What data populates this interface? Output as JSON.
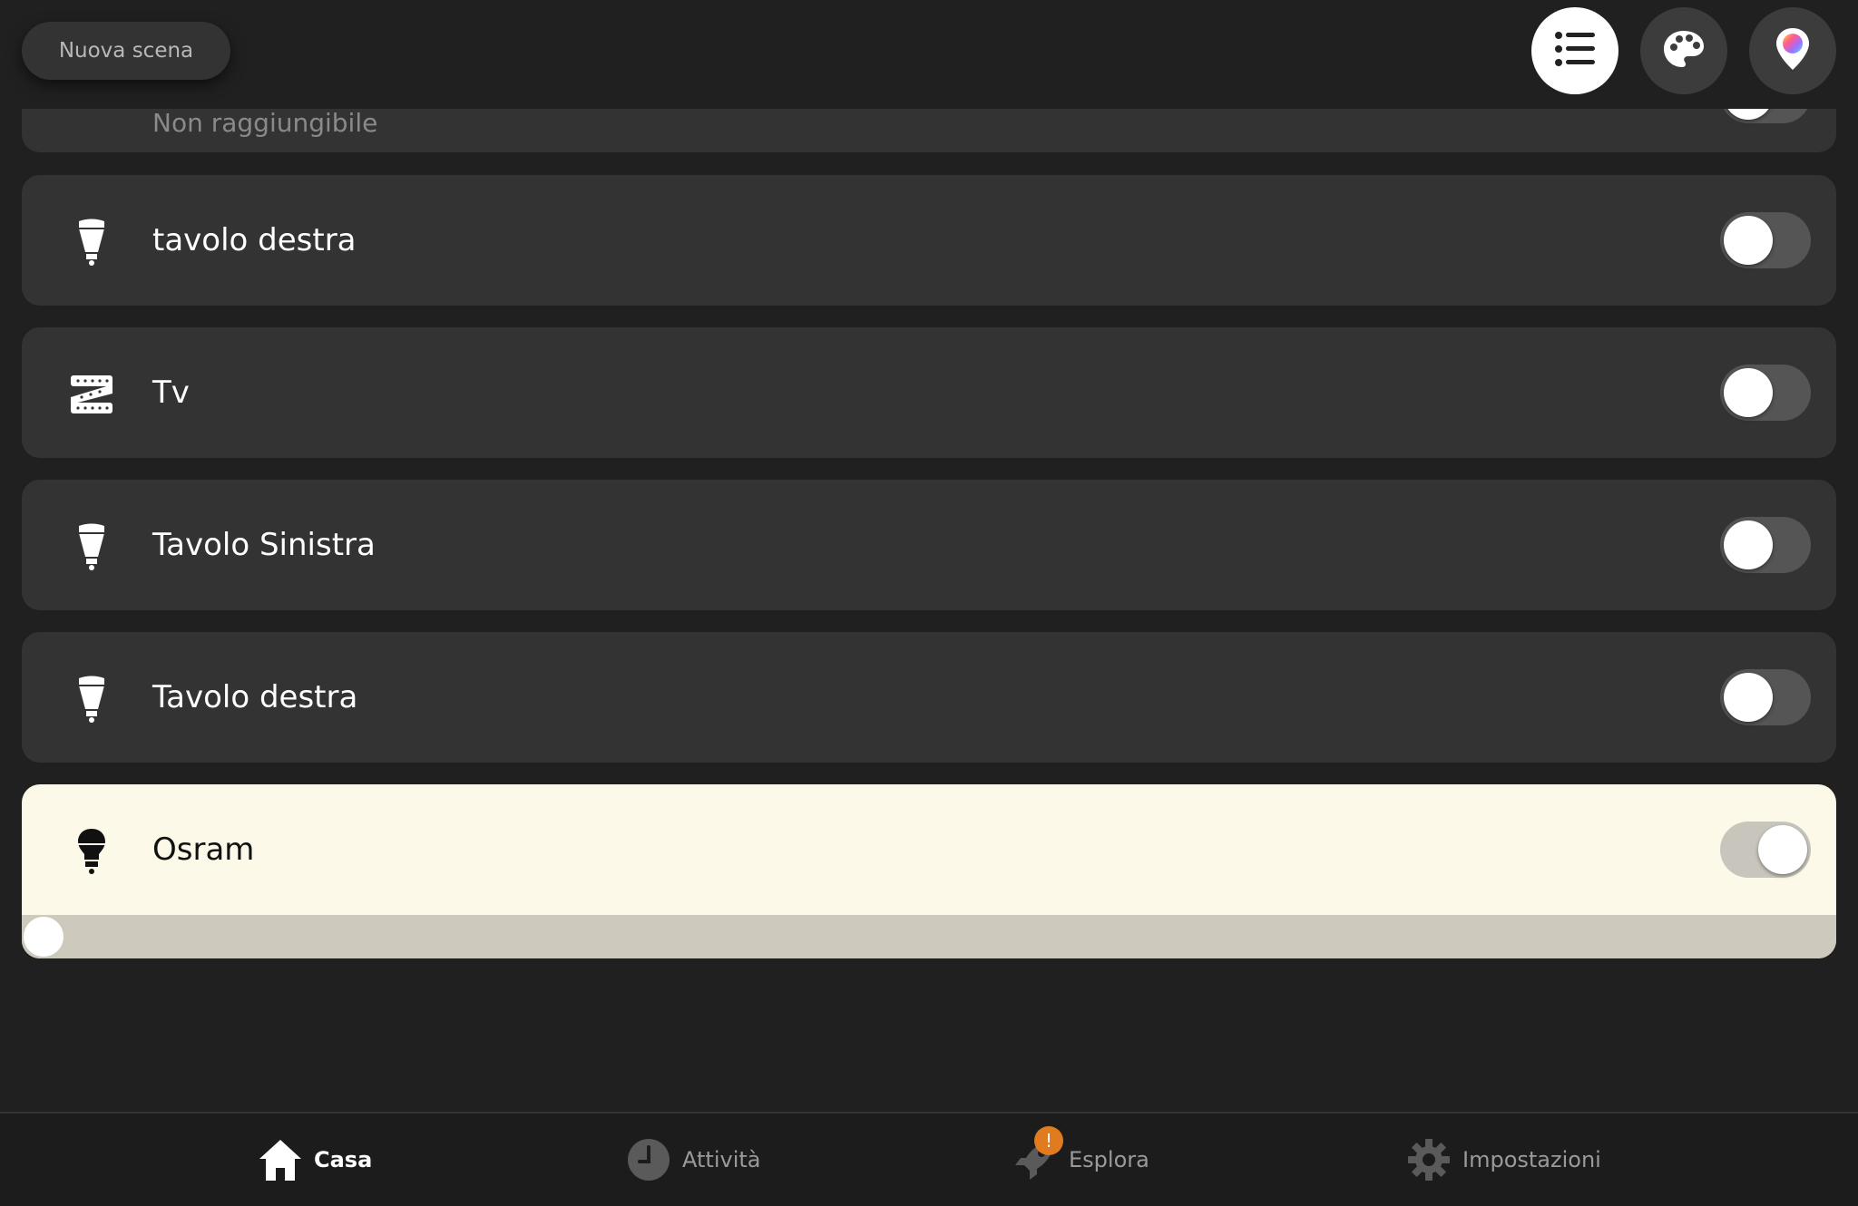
{
  "top_bar": {
    "new_scene_label": "Nuova scena",
    "buttons": [
      "list-view-icon",
      "palette-icon",
      "color-location-icon"
    ]
  },
  "lights": [
    {
      "name": "Non raggiungibile",
      "icon": "lightstrip-icon",
      "on": false,
      "partial": true
    },
    {
      "name": "tavolo destra",
      "icon": "spot-bulb-icon",
      "on": false
    },
    {
      "name": "Tv",
      "icon": "lightstrip-icon",
      "on": false
    },
    {
      "name": "Tavolo Sinistra",
      "icon": "spot-bulb-icon",
      "on": false
    },
    {
      "name": "Tavolo destra",
      "icon": "spot-bulb-icon",
      "on": false
    },
    {
      "name": "Osram",
      "icon": "bulb-icon",
      "on": true,
      "brightness_fraction": 0.0
    }
  ],
  "nav": {
    "home": "Casa",
    "activity": "Attività",
    "explore": "Esplora",
    "explore_badge": "!",
    "settings": "Impostazioni"
  },
  "colors": {
    "background": "#202020",
    "card": "#333333",
    "lit_card": "#fdf9e8",
    "badge": "#e07b1f"
  }
}
